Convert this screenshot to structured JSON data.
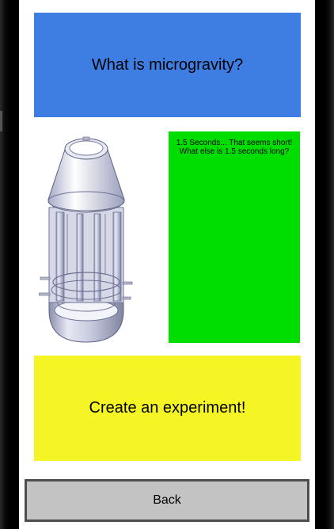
{
  "top_panel": {
    "title": "What is microgravity?",
    "color": "#3e7ee3"
  },
  "image": {
    "icon": "drop-capsule-image"
  },
  "info_panel": {
    "line1": "1.5 Seconds... That seems short!",
    "line2": "What else is 1.5 seconds long?",
    "color": "#00dd00"
  },
  "action_panel": {
    "label": "Create an experiment!",
    "color": "#f5f526"
  },
  "footer": {
    "back_label": "Back"
  }
}
